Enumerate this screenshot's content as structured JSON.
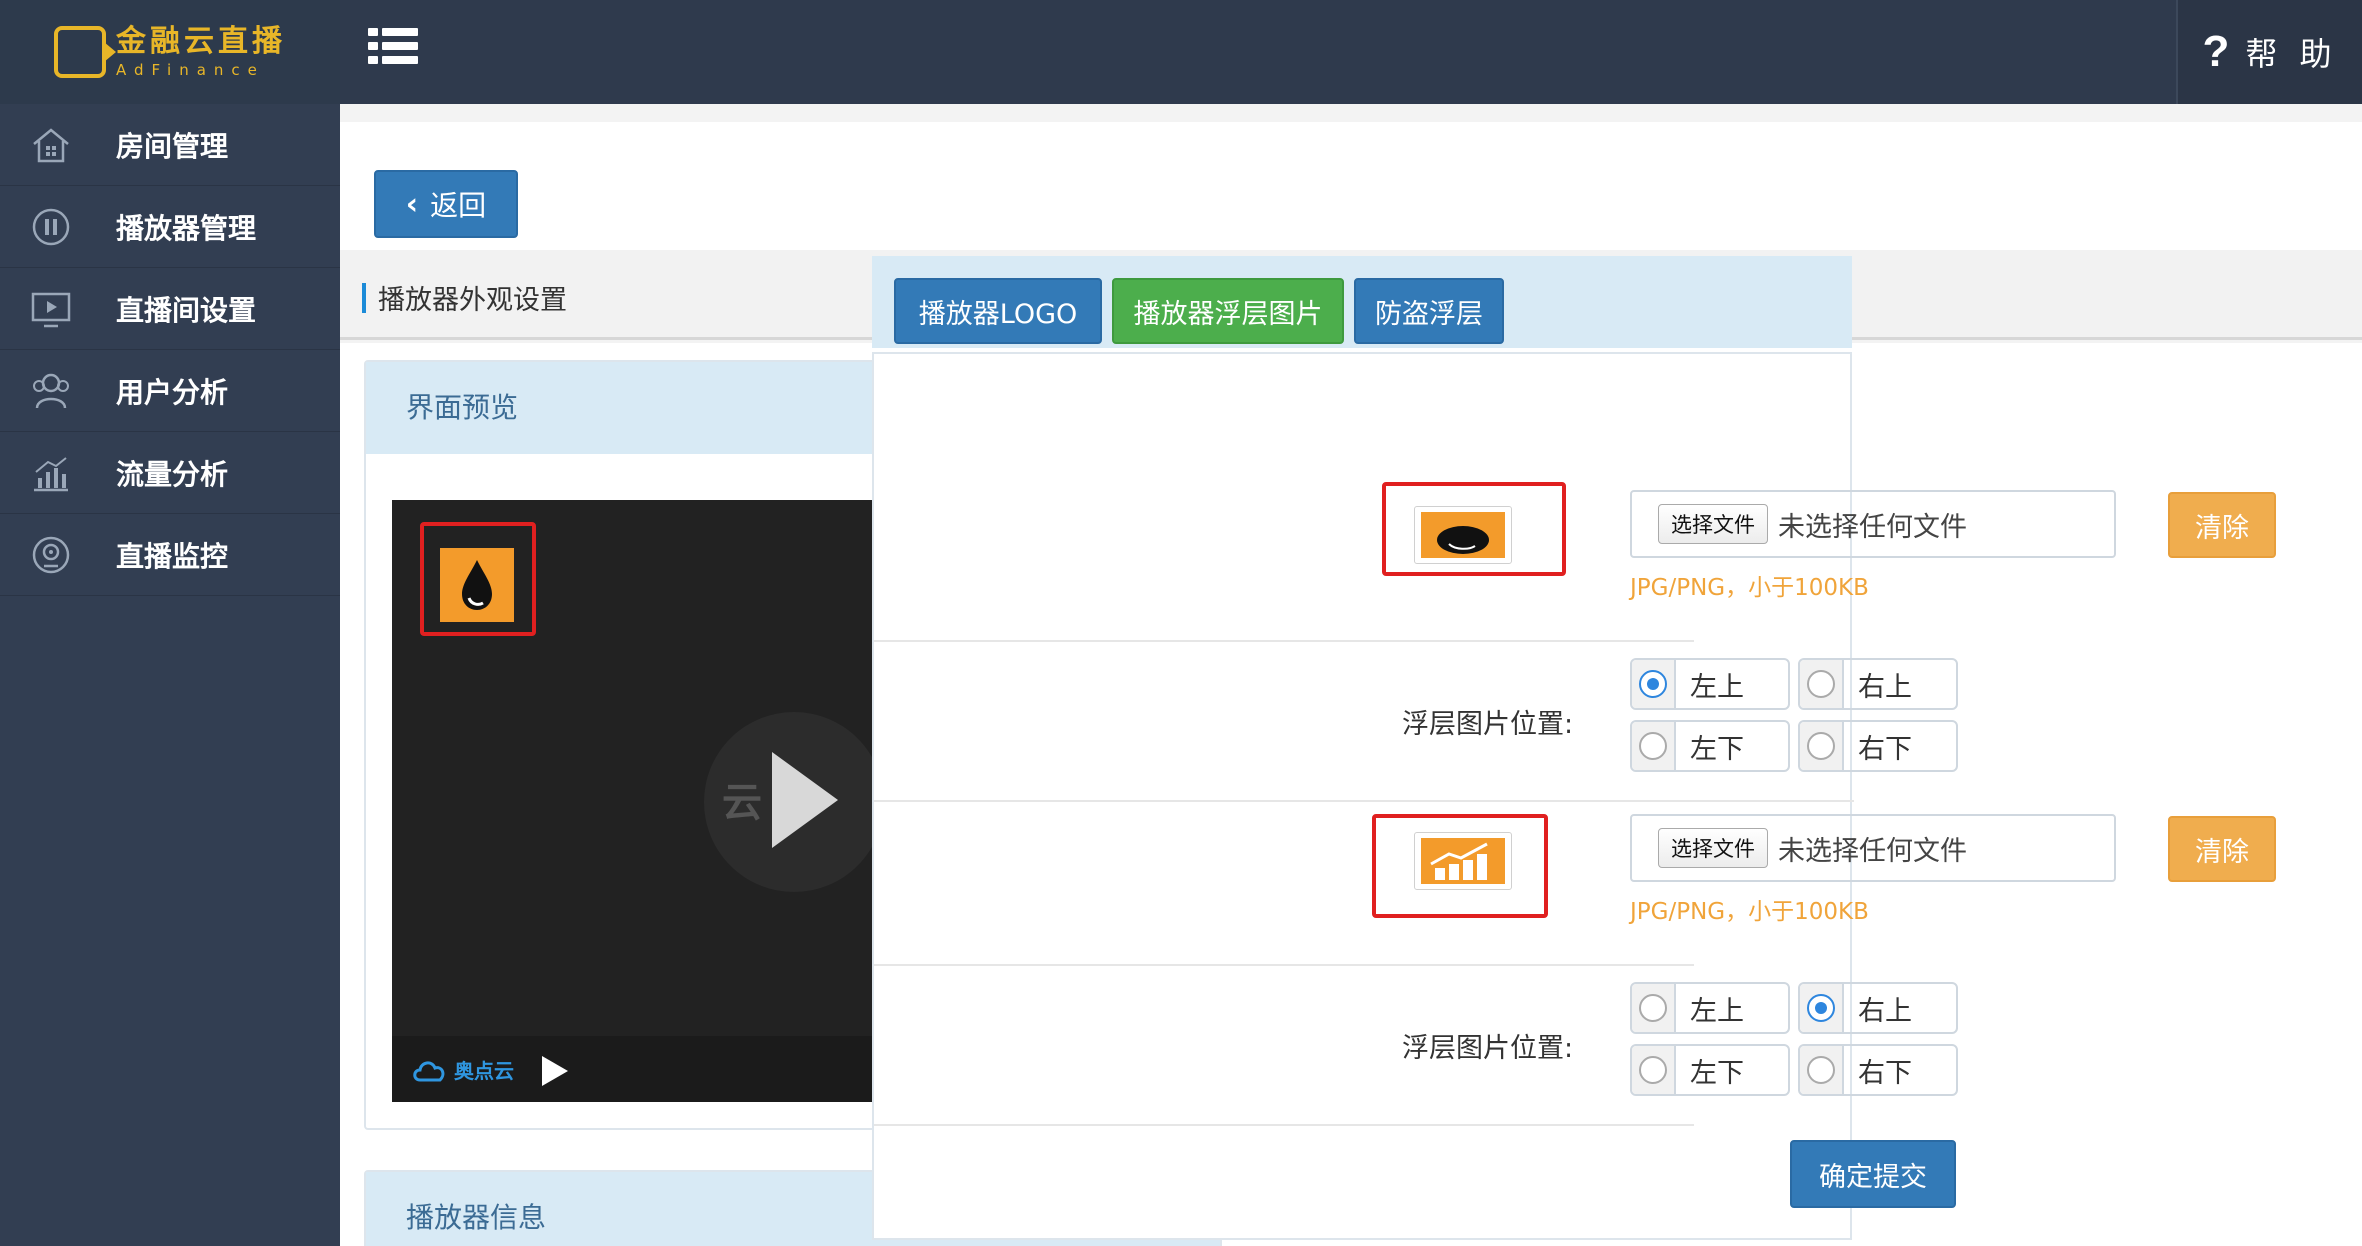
{
  "app": {
    "logo_title": "金融云直播",
    "logo_subtitle": "AdFinance",
    "help_label": "帮 助"
  },
  "sidebar": {
    "items": [
      {
        "label": "房间管理",
        "icon": "home-icon"
      },
      {
        "label": "播放器管理",
        "icon": "pause-circle-icon"
      },
      {
        "label": "直播间设置",
        "icon": "monitor-play-icon"
      },
      {
        "label": "用户分析",
        "icon": "users-icon"
      },
      {
        "label": "流量分析",
        "icon": "bar-chart-icon"
      },
      {
        "label": "直播监控",
        "icon": "monitor-target-icon"
      }
    ]
  },
  "toolbar": {
    "back_label": "返回"
  },
  "section": {
    "title": "播放器外观设置"
  },
  "preview": {
    "title": "界面预览",
    "brand": "奥点云",
    "watermark": "云"
  },
  "player_info": {
    "title": "播放器信息"
  },
  "tabs": [
    {
      "label": "播放器LOGO",
      "active": false
    },
    {
      "label": "播放器浮层图片",
      "active": true
    },
    {
      "label": "防盗浮层",
      "active": false
    }
  ],
  "overlays": [
    {
      "file_button": "选择文件",
      "file_status": "未选择任何文件",
      "hint": "JPG/PNG，小于100KB",
      "clear_label": "清除",
      "position_label": "浮层图片位置:",
      "positions": [
        "左上",
        "右上",
        "左下",
        "右下"
      ],
      "selected": "左上"
    },
    {
      "file_button": "选择文件",
      "file_status": "未选择任何文件",
      "hint": "JPG/PNG，小于100KB",
      "clear_label": "清除",
      "position_label": "浮层图片位置:",
      "positions": [
        "左上",
        "右上",
        "左下",
        "右下"
      ],
      "selected": "右上"
    }
  ],
  "form": {
    "submit_label": "确定提交"
  },
  "colors": {
    "topbar": "#2f3a4d",
    "sidebar": "#323e52",
    "primary": "#337ab7",
    "success": "#4cae4c",
    "warning": "#f0ad4e",
    "highlight": "#e02020",
    "overlay_orange": "#f39b2b"
  }
}
